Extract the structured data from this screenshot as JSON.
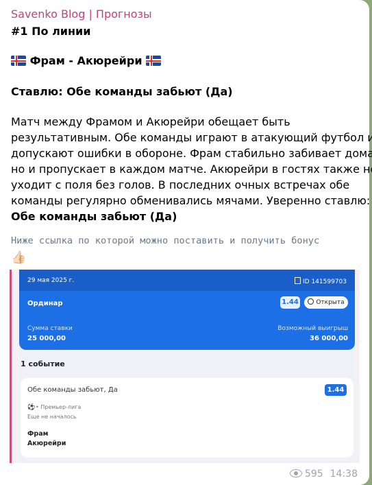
{
  "post": {
    "channel": "Savenko Blog | Прогнозы",
    "heading": "#1 По линии",
    "match": "Фрам - Акюрейри",
    "bet": "Ставлю: Обе команды забьют (Да)",
    "body_lines": [
      "Матч между Фрамом и Акюрейри обещает быть",
      "результативным. Обе команды играют в атакующий футбол и",
      "допускают ошибки в обороне. Фрам стабильно забивает дома,",
      "но и пропускает в каждом матче. Акюрейри в гостях также не",
      "уходит с поля без голов. В последних очных встречах обе",
      "команды регулярно обменивались мячами. Уверенно ставлю:"
    ],
    "conclusion": "Обе команды забьют (Да)",
    "link_text": "Ниже ссылка по которой можно поставить и получить бонус",
    "thumb": "👍🏻",
    "views": "595",
    "time": "14:38"
  },
  "bet_slip": {
    "date": "29 мая 2025 г.",
    "id": "ID 141599703",
    "type": "Ординар",
    "odds": "1.44",
    "status": "Открыта",
    "stake_label": "Сумма ставки",
    "stake_value": "25 000,00",
    "win_label": "Возможный выигрыш",
    "win_value": "36 000,00",
    "events_count": "1 событие",
    "event": {
      "name": "Обе команды забьют, Да",
      "odds": "1.44",
      "league": "• Премьер-лига",
      "status": "Еще не началось",
      "team1": "Фрам",
      "team2": "Акюрейри"
    }
  },
  "icons": {
    "flag": "iceland-flag-icon",
    "ball": "soccer-ball-icon",
    "eye": "eye-icon",
    "clock": "clock-icon",
    "doc": "document-icon"
  },
  "colors": {
    "channel": "#c0437a",
    "accent": "#1d6fe6",
    "card_stripe": "#d34b7a"
  }
}
